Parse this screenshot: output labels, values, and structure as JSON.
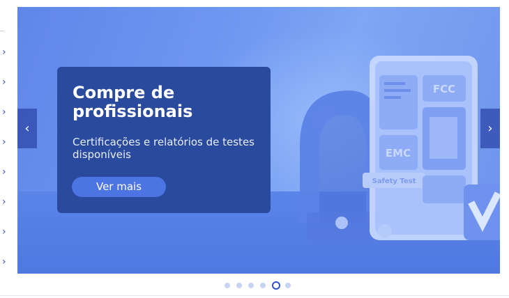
{
  "banner": {
    "title": "Compre de profissionais",
    "subtitle": "Certificações e relatórios de testes disponíveis",
    "cta_label": "Ver mais",
    "prev_arrow": "‹",
    "next_arrow": "›",
    "illustration": {
      "fcc_label": "FCC",
      "emc_label": "EMC",
      "safety_label": "Safety Test"
    },
    "colors": {
      "card_bg": "#2a4a9d",
      "button_bg": "#4d74e3",
      "banner_bg": "#6f98f1"
    }
  },
  "sidebar": {
    "chevron": "›",
    "item_count_visible": 8
  },
  "carousel": {
    "slide_count": 6,
    "active_index": 4
  }
}
